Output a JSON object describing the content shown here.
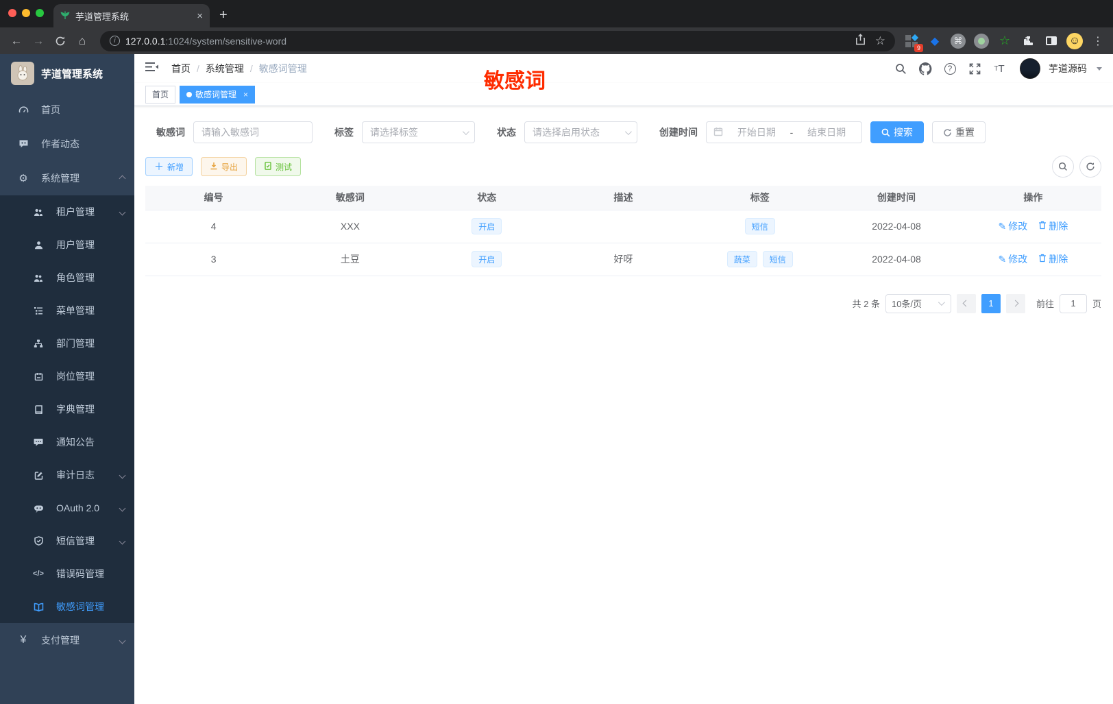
{
  "colors": {
    "primary": "#409EFF",
    "warning": "#E6A23C",
    "success": "#67C23A",
    "danger": "#F56C6C",
    "annotation_red": "#FE2C00",
    "sidebar_bg": "#304156",
    "submenu_bg": "#1f2d3d"
  },
  "browser": {
    "tab_title": "芋道管理系统",
    "close_tab": "×",
    "new_tab": "+",
    "url_host": "127.0.0.1",
    "url_rest": ":1024/system/sensitive-word",
    "extension_badge": "9",
    "kebab": "⋮"
  },
  "sidebar": {
    "logo_title": "芋道管理系统",
    "items": [
      {
        "label": "首页"
      },
      {
        "label": "作者动态"
      },
      {
        "label": "系统管理"
      },
      {
        "label": "租户管理"
      },
      {
        "label": "用户管理"
      },
      {
        "label": "角色管理"
      },
      {
        "label": "菜单管理"
      },
      {
        "label": "部门管理"
      },
      {
        "label": "岗位管理"
      },
      {
        "label": "字典管理"
      },
      {
        "label": "通知公告"
      },
      {
        "label": "审计日志"
      },
      {
        "label": "OAuth 2.0"
      },
      {
        "label": "短信管理"
      },
      {
        "label": "错误码管理"
      },
      {
        "label": "敏感词管理"
      },
      {
        "label": "支付管理"
      }
    ]
  },
  "header": {
    "breadcrumb": [
      "首页",
      "系统管理",
      "敏感词管理"
    ],
    "separator": "/",
    "user_name": "芋道源码",
    "annotation": "敏感词",
    "help_glyph": "?"
  },
  "tags_view": [
    {
      "label": "首页"
    },
    {
      "label": "敏感词管理",
      "close": "×"
    }
  ],
  "filter": {
    "keyword_label": "敏感词",
    "keyword_placeholder": "请输入敏感词",
    "tag_label": "标签",
    "tag_placeholder": "请选择标签",
    "status_label": "状态",
    "status_placeholder": "请选择启用状态",
    "date_label": "创建时间",
    "date_start_placeholder": "开始日期",
    "date_separator": "-",
    "date_end_placeholder": "结束日期",
    "search_label": "搜索",
    "reset_label": "重置"
  },
  "toolbar": {
    "add_label": "新增",
    "export_label": "导出",
    "test_label": "测试"
  },
  "table": {
    "columns": [
      "编号",
      "敏感词",
      "状态",
      "描述",
      "标签",
      "创建时间",
      "操作"
    ],
    "actions": {
      "edit": "修改",
      "delete": "删除"
    },
    "rows": [
      {
        "id": "4",
        "word": "XXX",
        "status": "开启",
        "desc": "",
        "tags": [
          "短信"
        ],
        "created": "2022-04-08"
      },
      {
        "id": "3",
        "word": "土豆",
        "status": "开启",
        "desc": "好呀",
        "tags": [
          "蔬菜",
          "短信"
        ],
        "created": "2022-04-08"
      }
    ]
  },
  "pagination": {
    "total_text": "共 2 条",
    "page_size": "10条/页",
    "current_page": "1",
    "goto_prefix": "前往",
    "goto_value": "1",
    "goto_suffix": "页"
  }
}
